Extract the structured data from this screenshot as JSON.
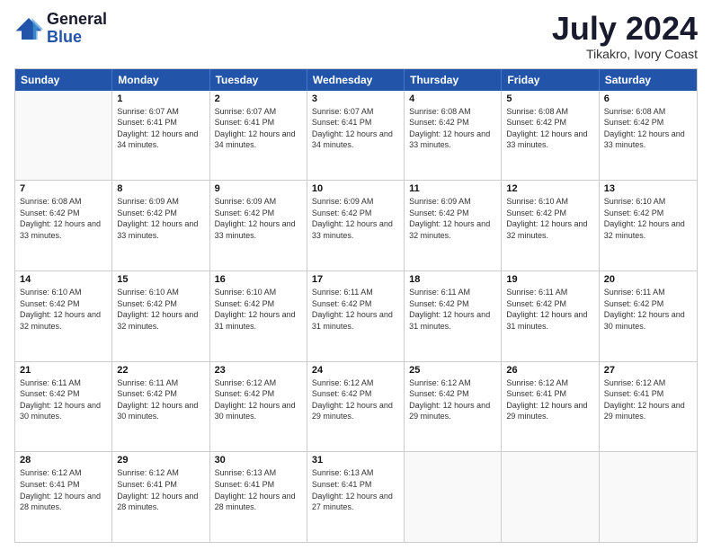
{
  "logo": {
    "general": "General",
    "blue": "Blue"
  },
  "header": {
    "month": "July 2024",
    "location": "Tikakro, Ivory Coast"
  },
  "weekdays": [
    "Sunday",
    "Monday",
    "Tuesday",
    "Wednesday",
    "Thursday",
    "Friday",
    "Saturday"
  ],
  "weeks": [
    [
      {
        "day": "",
        "sunrise": "",
        "sunset": "",
        "daylight": ""
      },
      {
        "day": "1",
        "sunrise": "Sunrise: 6:07 AM",
        "sunset": "Sunset: 6:41 PM",
        "daylight": "Daylight: 12 hours and 34 minutes."
      },
      {
        "day": "2",
        "sunrise": "Sunrise: 6:07 AM",
        "sunset": "Sunset: 6:41 PM",
        "daylight": "Daylight: 12 hours and 34 minutes."
      },
      {
        "day": "3",
        "sunrise": "Sunrise: 6:07 AM",
        "sunset": "Sunset: 6:41 PM",
        "daylight": "Daylight: 12 hours and 34 minutes."
      },
      {
        "day": "4",
        "sunrise": "Sunrise: 6:08 AM",
        "sunset": "Sunset: 6:42 PM",
        "daylight": "Daylight: 12 hours and 33 minutes."
      },
      {
        "day": "5",
        "sunrise": "Sunrise: 6:08 AM",
        "sunset": "Sunset: 6:42 PM",
        "daylight": "Daylight: 12 hours and 33 minutes."
      },
      {
        "day": "6",
        "sunrise": "Sunrise: 6:08 AM",
        "sunset": "Sunset: 6:42 PM",
        "daylight": "Daylight: 12 hours and 33 minutes."
      }
    ],
    [
      {
        "day": "7",
        "sunrise": "Sunrise: 6:08 AM",
        "sunset": "Sunset: 6:42 PM",
        "daylight": "Daylight: 12 hours and 33 minutes."
      },
      {
        "day": "8",
        "sunrise": "Sunrise: 6:09 AM",
        "sunset": "Sunset: 6:42 PM",
        "daylight": "Daylight: 12 hours and 33 minutes."
      },
      {
        "day": "9",
        "sunrise": "Sunrise: 6:09 AM",
        "sunset": "Sunset: 6:42 PM",
        "daylight": "Daylight: 12 hours and 33 minutes."
      },
      {
        "day": "10",
        "sunrise": "Sunrise: 6:09 AM",
        "sunset": "Sunset: 6:42 PM",
        "daylight": "Daylight: 12 hours and 33 minutes."
      },
      {
        "day": "11",
        "sunrise": "Sunrise: 6:09 AM",
        "sunset": "Sunset: 6:42 PM",
        "daylight": "Daylight: 12 hours and 32 minutes."
      },
      {
        "day": "12",
        "sunrise": "Sunrise: 6:10 AM",
        "sunset": "Sunset: 6:42 PM",
        "daylight": "Daylight: 12 hours and 32 minutes."
      },
      {
        "day": "13",
        "sunrise": "Sunrise: 6:10 AM",
        "sunset": "Sunset: 6:42 PM",
        "daylight": "Daylight: 12 hours and 32 minutes."
      }
    ],
    [
      {
        "day": "14",
        "sunrise": "Sunrise: 6:10 AM",
        "sunset": "Sunset: 6:42 PM",
        "daylight": "Daylight: 12 hours and 32 minutes."
      },
      {
        "day": "15",
        "sunrise": "Sunrise: 6:10 AM",
        "sunset": "Sunset: 6:42 PM",
        "daylight": "Daylight: 12 hours and 32 minutes."
      },
      {
        "day": "16",
        "sunrise": "Sunrise: 6:10 AM",
        "sunset": "Sunset: 6:42 PM",
        "daylight": "Daylight: 12 hours and 31 minutes."
      },
      {
        "day": "17",
        "sunrise": "Sunrise: 6:11 AM",
        "sunset": "Sunset: 6:42 PM",
        "daylight": "Daylight: 12 hours and 31 minutes."
      },
      {
        "day": "18",
        "sunrise": "Sunrise: 6:11 AM",
        "sunset": "Sunset: 6:42 PM",
        "daylight": "Daylight: 12 hours and 31 minutes."
      },
      {
        "day": "19",
        "sunrise": "Sunrise: 6:11 AM",
        "sunset": "Sunset: 6:42 PM",
        "daylight": "Daylight: 12 hours and 31 minutes."
      },
      {
        "day": "20",
        "sunrise": "Sunrise: 6:11 AM",
        "sunset": "Sunset: 6:42 PM",
        "daylight": "Daylight: 12 hours and 30 minutes."
      }
    ],
    [
      {
        "day": "21",
        "sunrise": "Sunrise: 6:11 AM",
        "sunset": "Sunset: 6:42 PM",
        "daylight": "Daylight: 12 hours and 30 minutes."
      },
      {
        "day": "22",
        "sunrise": "Sunrise: 6:11 AM",
        "sunset": "Sunset: 6:42 PM",
        "daylight": "Daylight: 12 hours and 30 minutes."
      },
      {
        "day": "23",
        "sunrise": "Sunrise: 6:12 AM",
        "sunset": "Sunset: 6:42 PM",
        "daylight": "Daylight: 12 hours and 30 minutes."
      },
      {
        "day": "24",
        "sunrise": "Sunrise: 6:12 AM",
        "sunset": "Sunset: 6:42 PM",
        "daylight": "Daylight: 12 hours and 29 minutes."
      },
      {
        "day": "25",
        "sunrise": "Sunrise: 6:12 AM",
        "sunset": "Sunset: 6:42 PM",
        "daylight": "Daylight: 12 hours and 29 minutes."
      },
      {
        "day": "26",
        "sunrise": "Sunrise: 6:12 AM",
        "sunset": "Sunset: 6:41 PM",
        "daylight": "Daylight: 12 hours and 29 minutes."
      },
      {
        "day": "27",
        "sunrise": "Sunrise: 6:12 AM",
        "sunset": "Sunset: 6:41 PM",
        "daylight": "Daylight: 12 hours and 29 minutes."
      }
    ],
    [
      {
        "day": "28",
        "sunrise": "Sunrise: 6:12 AM",
        "sunset": "Sunset: 6:41 PM",
        "daylight": "Daylight: 12 hours and 28 minutes."
      },
      {
        "day": "29",
        "sunrise": "Sunrise: 6:12 AM",
        "sunset": "Sunset: 6:41 PM",
        "daylight": "Daylight: 12 hours and 28 minutes."
      },
      {
        "day": "30",
        "sunrise": "Sunrise: 6:13 AM",
        "sunset": "Sunset: 6:41 PM",
        "daylight": "Daylight: 12 hours and 28 minutes."
      },
      {
        "day": "31",
        "sunrise": "Sunrise: 6:13 AM",
        "sunset": "Sunset: 6:41 PM",
        "daylight": "Daylight: 12 hours and 27 minutes."
      },
      {
        "day": "",
        "sunrise": "",
        "sunset": "",
        "daylight": ""
      },
      {
        "day": "",
        "sunrise": "",
        "sunset": "",
        "daylight": ""
      },
      {
        "day": "",
        "sunrise": "",
        "sunset": "",
        "daylight": ""
      }
    ]
  ]
}
